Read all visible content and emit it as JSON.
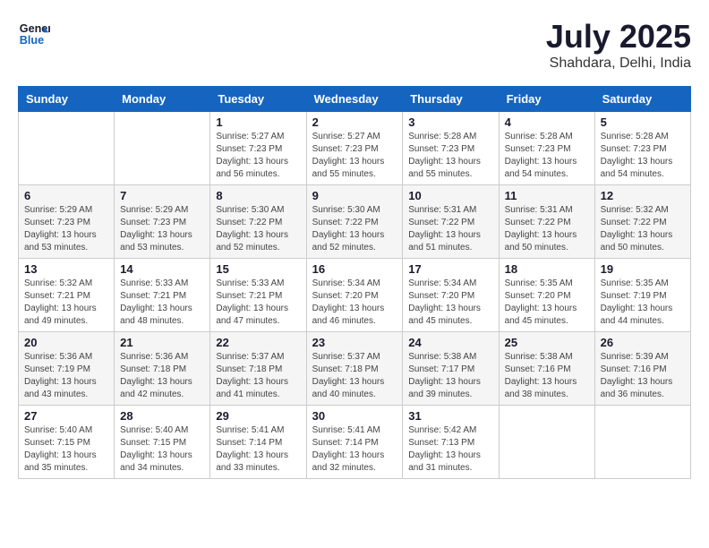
{
  "header": {
    "logo_line1": "General",
    "logo_line2": "Blue",
    "month": "July 2025",
    "location": "Shahdara, Delhi, India"
  },
  "days_of_week": [
    "Sunday",
    "Monday",
    "Tuesday",
    "Wednesday",
    "Thursday",
    "Friday",
    "Saturday"
  ],
  "weeks": [
    [
      {
        "day": "",
        "info": ""
      },
      {
        "day": "",
        "info": ""
      },
      {
        "day": "1",
        "info": "Sunrise: 5:27 AM\nSunset: 7:23 PM\nDaylight: 13 hours\nand 56 minutes."
      },
      {
        "day": "2",
        "info": "Sunrise: 5:27 AM\nSunset: 7:23 PM\nDaylight: 13 hours\nand 55 minutes."
      },
      {
        "day": "3",
        "info": "Sunrise: 5:28 AM\nSunset: 7:23 PM\nDaylight: 13 hours\nand 55 minutes."
      },
      {
        "day": "4",
        "info": "Sunrise: 5:28 AM\nSunset: 7:23 PM\nDaylight: 13 hours\nand 54 minutes."
      },
      {
        "day": "5",
        "info": "Sunrise: 5:28 AM\nSunset: 7:23 PM\nDaylight: 13 hours\nand 54 minutes."
      }
    ],
    [
      {
        "day": "6",
        "info": "Sunrise: 5:29 AM\nSunset: 7:23 PM\nDaylight: 13 hours\nand 53 minutes."
      },
      {
        "day": "7",
        "info": "Sunrise: 5:29 AM\nSunset: 7:23 PM\nDaylight: 13 hours\nand 53 minutes."
      },
      {
        "day": "8",
        "info": "Sunrise: 5:30 AM\nSunset: 7:22 PM\nDaylight: 13 hours\nand 52 minutes."
      },
      {
        "day": "9",
        "info": "Sunrise: 5:30 AM\nSunset: 7:22 PM\nDaylight: 13 hours\nand 52 minutes."
      },
      {
        "day": "10",
        "info": "Sunrise: 5:31 AM\nSunset: 7:22 PM\nDaylight: 13 hours\nand 51 minutes."
      },
      {
        "day": "11",
        "info": "Sunrise: 5:31 AM\nSunset: 7:22 PM\nDaylight: 13 hours\nand 50 minutes."
      },
      {
        "day": "12",
        "info": "Sunrise: 5:32 AM\nSunset: 7:22 PM\nDaylight: 13 hours\nand 50 minutes."
      }
    ],
    [
      {
        "day": "13",
        "info": "Sunrise: 5:32 AM\nSunset: 7:21 PM\nDaylight: 13 hours\nand 49 minutes."
      },
      {
        "day": "14",
        "info": "Sunrise: 5:33 AM\nSunset: 7:21 PM\nDaylight: 13 hours\nand 48 minutes."
      },
      {
        "day": "15",
        "info": "Sunrise: 5:33 AM\nSunset: 7:21 PM\nDaylight: 13 hours\nand 47 minutes."
      },
      {
        "day": "16",
        "info": "Sunrise: 5:34 AM\nSunset: 7:20 PM\nDaylight: 13 hours\nand 46 minutes."
      },
      {
        "day": "17",
        "info": "Sunrise: 5:34 AM\nSunset: 7:20 PM\nDaylight: 13 hours\nand 45 minutes."
      },
      {
        "day": "18",
        "info": "Sunrise: 5:35 AM\nSunset: 7:20 PM\nDaylight: 13 hours\nand 45 minutes."
      },
      {
        "day": "19",
        "info": "Sunrise: 5:35 AM\nSunset: 7:19 PM\nDaylight: 13 hours\nand 44 minutes."
      }
    ],
    [
      {
        "day": "20",
        "info": "Sunrise: 5:36 AM\nSunset: 7:19 PM\nDaylight: 13 hours\nand 43 minutes."
      },
      {
        "day": "21",
        "info": "Sunrise: 5:36 AM\nSunset: 7:18 PM\nDaylight: 13 hours\nand 42 minutes."
      },
      {
        "day": "22",
        "info": "Sunrise: 5:37 AM\nSunset: 7:18 PM\nDaylight: 13 hours\nand 41 minutes."
      },
      {
        "day": "23",
        "info": "Sunrise: 5:37 AM\nSunset: 7:18 PM\nDaylight: 13 hours\nand 40 minutes."
      },
      {
        "day": "24",
        "info": "Sunrise: 5:38 AM\nSunset: 7:17 PM\nDaylight: 13 hours\nand 39 minutes."
      },
      {
        "day": "25",
        "info": "Sunrise: 5:38 AM\nSunset: 7:16 PM\nDaylight: 13 hours\nand 38 minutes."
      },
      {
        "day": "26",
        "info": "Sunrise: 5:39 AM\nSunset: 7:16 PM\nDaylight: 13 hours\nand 36 minutes."
      }
    ],
    [
      {
        "day": "27",
        "info": "Sunrise: 5:40 AM\nSunset: 7:15 PM\nDaylight: 13 hours\nand 35 minutes."
      },
      {
        "day": "28",
        "info": "Sunrise: 5:40 AM\nSunset: 7:15 PM\nDaylight: 13 hours\nand 34 minutes."
      },
      {
        "day": "29",
        "info": "Sunrise: 5:41 AM\nSunset: 7:14 PM\nDaylight: 13 hours\nand 33 minutes."
      },
      {
        "day": "30",
        "info": "Sunrise: 5:41 AM\nSunset: 7:14 PM\nDaylight: 13 hours\nand 32 minutes."
      },
      {
        "day": "31",
        "info": "Sunrise: 5:42 AM\nSunset: 7:13 PM\nDaylight: 13 hours\nand 31 minutes."
      },
      {
        "day": "",
        "info": ""
      },
      {
        "day": "",
        "info": ""
      }
    ]
  ]
}
